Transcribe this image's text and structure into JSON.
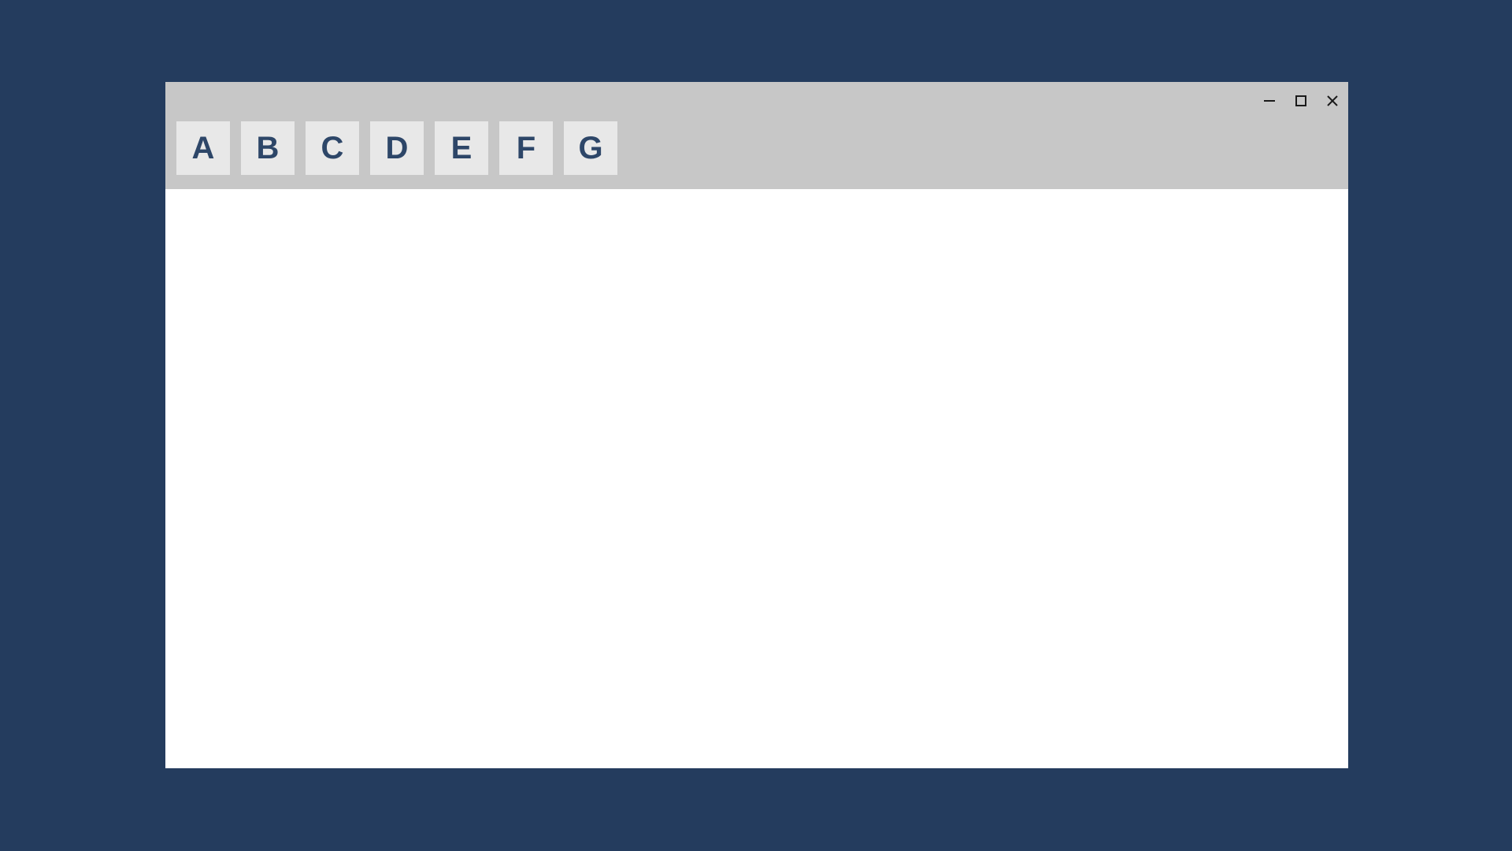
{
  "toolbar": {
    "buttons": [
      "A",
      "B",
      "C",
      "D",
      "E",
      "F",
      "G"
    ]
  }
}
